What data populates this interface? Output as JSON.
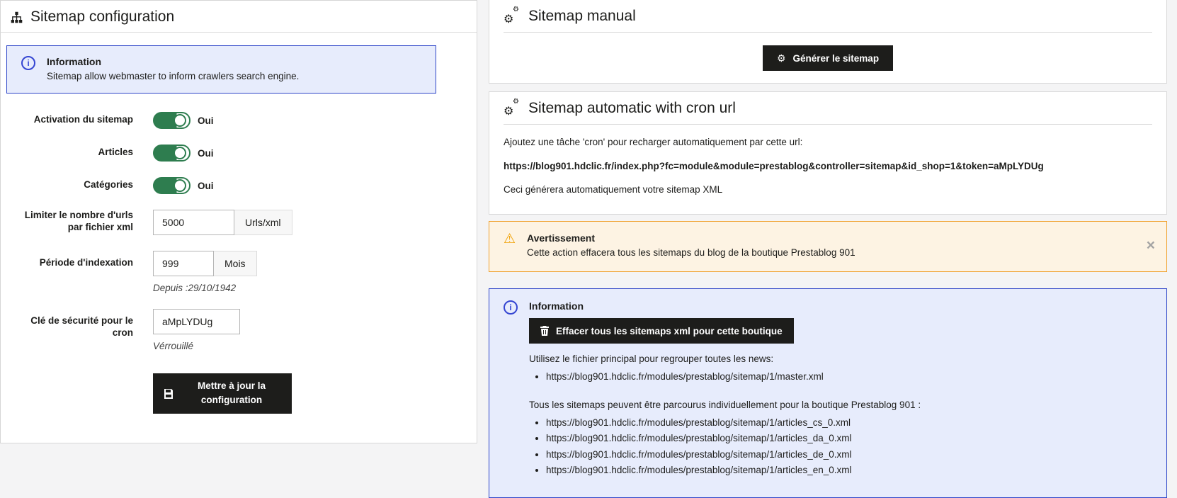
{
  "colors": {
    "accent-green": "#2e7d4f",
    "info-border": "#2e45c8",
    "info-bg": "#e7ecfc",
    "warning-border": "#f0a12e",
    "warning-bg": "#fdf3e3",
    "button-bg": "#1d1d1b",
    "page-bg": "#f4f4f5"
  },
  "icons": {
    "gear": "⚙",
    "warning": "⚠",
    "info": "i",
    "close": "×"
  },
  "config_panel": {
    "title": "Sitemap configuration",
    "info_alert": {
      "title": "Information",
      "text": "Sitemap allow webmaster to inform crawlers search engine."
    },
    "toggles": [
      {
        "label": "Activation du sitemap",
        "state": "Oui"
      },
      {
        "label": "Articles",
        "state": "Oui"
      },
      {
        "label": "Catégories",
        "state": "Oui"
      }
    ],
    "url_limit": {
      "label": "Limiter le nombre d'urls par fichier xml",
      "value": "5000",
      "unit": "Urls/xml"
    },
    "index_period": {
      "label": "Période d'indexation",
      "value": "999",
      "unit": "Mois",
      "help": "Depuis :29/10/1942"
    },
    "cron_key": {
      "label": "Clé de sécurité pour le cron",
      "value": "aMpLYDUg",
      "help": "Vérrouillé"
    },
    "submit_label": "Mettre à jour la configuration"
  },
  "manual_panel": {
    "title": "Sitemap manual",
    "generate_label": "Générer le sitemap"
  },
  "cron_panel": {
    "title": "Sitemap automatic with cron url",
    "intro": "Ajoutez une tâche 'cron' pour recharger automatiquement par cette url:",
    "cron_url": "https://blog901.hdclic.fr/index.php?fc=module&module=prestablog&controller=sitemap&id_shop=1&token=aMpLYDUg",
    "note": "Ceci générera automatiquement votre sitemap XML"
  },
  "warning_alert": {
    "title": "Avertissement",
    "text": "Cette action effacera tous les sitemaps du blog de la boutique Prestablog 901"
  },
  "sitemaps_alert": {
    "title": "Information",
    "delete_button_label": "Effacer tous les sitemaps xml pour cette boutique",
    "master_intro": "Utilisez le fichier principal pour regrouper toutes les news:",
    "master_url": "https://blog901.hdclic.fr/modules/prestablog/sitemap/1/master.xml",
    "list_intro": "Tous les sitemaps peuvent être parcourus individuellement pour la boutique Prestablog 901 :",
    "urls": [
      "https://blog901.hdclic.fr/modules/prestablog/sitemap/1/articles_cs_0.xml",
      "https://blog901.hdclic.fr/modules/prestablog/sitemap/1/articles_da_0.xml",
      "https://blog901.hdclic.fr/modules/prestablog/sitemap/1/articles_de_0.xml",
      "https://blog901.hdclic.fr/modules/prestablog/sitemap/1/articles_en_0.xml"
    ]
  }
}
